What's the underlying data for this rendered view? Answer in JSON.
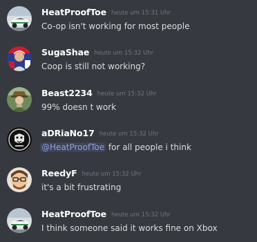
{
  "messages": [
    {
      "username": "HeatProofToe",
      "timestamp": "heute um 15:31 Uhr",
      "text": "Co-op isn't working for most people",
      "avatar": "car-avatar"
    },
    {
      "username": "SugaShae",
      "timestamp": "heute um 15:32 Uhr",
      "text": "Coop is still not working?",
      "avatar": "person-avatar"
    },
    {
      "username": "Beast2234",
      "timestamp": "heute um 15:32 Uhr",
      "text": "99% doesn t work",
      "avatar": "character-avatar"
    },
    {
      "username": "aDRiaNo17",
      "timestamp": "heute um 15:32 Uhr",
      "mention": "@HeatProofToe",
      "text": " for all people i think",
      "avatar": "emblem-avatar"
    },
    {
      "username": "ReedyF",
      "timestamp": "heute um 15:32 Uhr",
      "text": "it's a bit frustrating",
      "avatar": "cartoon-face-avatar"
    },
    {
      "username": "HeatProofToe",
      "timestamp": "heute um 15:32 Uhr",
      "text": "I think someone said it works fine on Xbox",
      "avatar": "car-avatar"
    }
  ],
  "colors": {
    "background": "#36393f",
    "username": "#ffffff",
    "timestamp": "#72767d",
    "text": "#dcddde",
    "mention": "#8ea1e1"
  }
}
